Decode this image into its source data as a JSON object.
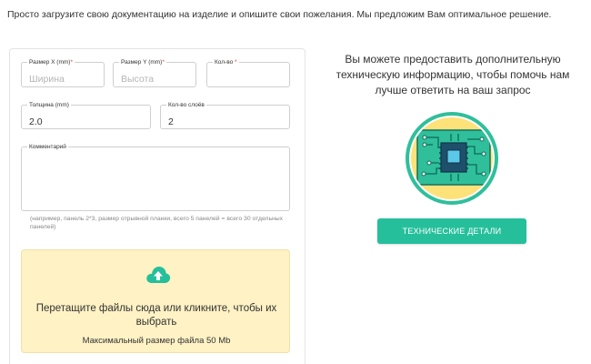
{
  "intro": "Просто загрузите свою документацию на изделие и опишите свои пожелания. Мы предложим Вам оптимальное решение.",
  "form": {
    "size_x": {
      "label": "Размер X",
      "unit": "(mm)",
      "required": "*",
      "placeholder": "Ширина",
      "value": ""
    },
    "size_y": {
      "label": "Размер Y",
      "unit": "(mm)",
      "required": "*",
      "placeholder": "Высота",
      "value": ""
    },
    "qty": {
      "label": "Кол-во",
      "required": "*",
      "value": ""
    },
    "thickness": {
      "label": "Толщина",
      "unit": "(mm)",
      "value": "2.0"
    },
    "layers": {
      "label": "Кол-во слоёв",
      "value": "2"
    },
    "comment": {
      "label": "Комментарий",
      "value": ""
    },
    "hint": "(например, панель 2*3, размер отрывной планки, всего 5 панелей = всего 30 отдельных панелей)"
  },
  "dropzone": {
    "icon": "cloud-upload-icon",
    "text": "Перетащите файлы сюда или кликните, чтобы их выбрать",
    "max_size": "Максимальный размер файла 50 Mb"
  },
  "info": {
    "text": "Вы можете предоставить дополнительную техническую информацию, чтобы помочь нам лучше ответить на ваш запрос",
    "illustration": "circuit-board-icon",
    "button_label": "ТЕХНИЧЕСКИЕ ДЕТАЛИ"
  },
  "colors": {
    "accent": "#26bf9c",
    "required": "#e53935",
    "dropzone_bg": "#fff2c4",
    "illustration_bg": "#fde27a"
  }
}
